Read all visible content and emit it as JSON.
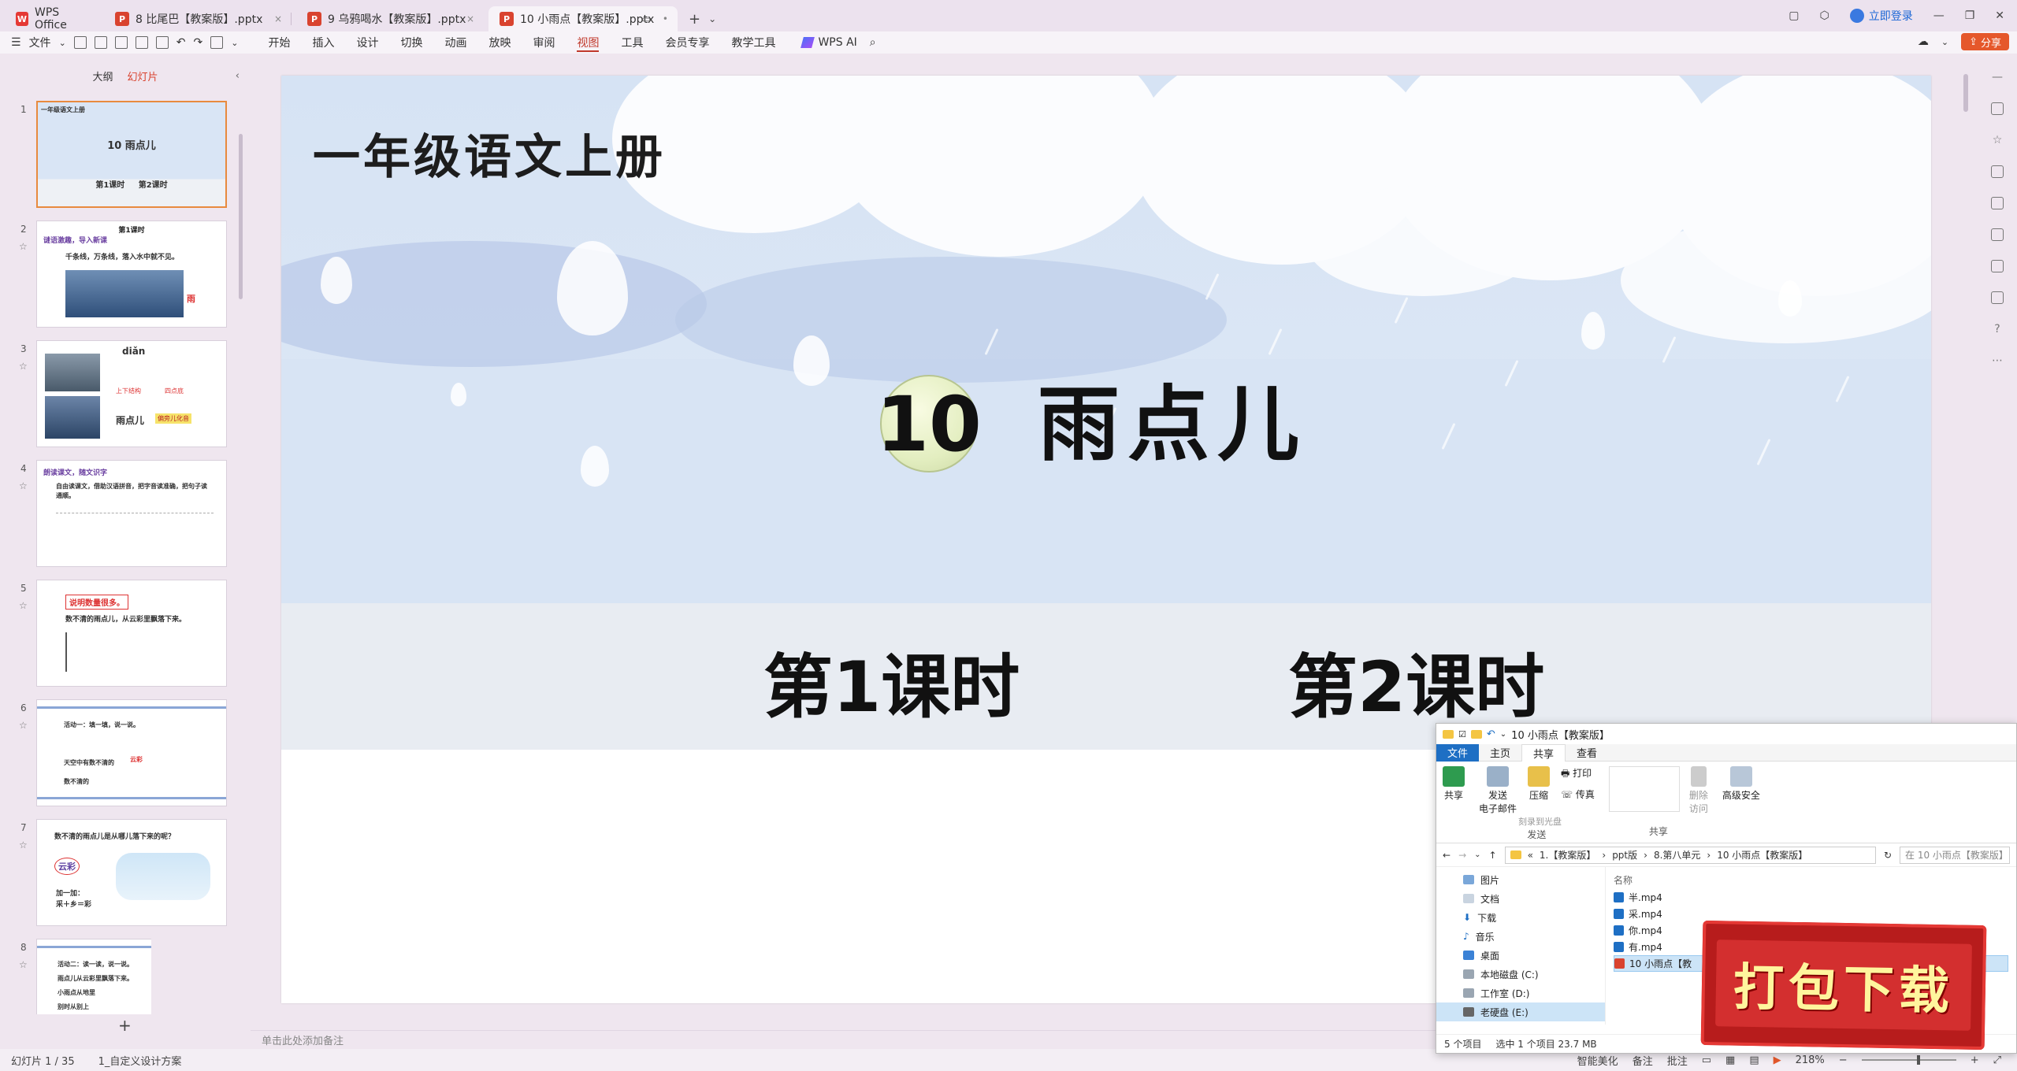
{
  "titlebar": {
    "tabs": [
      {
        "label": "WPS Office",
        "type": "home"
      },
      {
        "label": "8 比尾巴【教案版】.pptx",
        "type": "doc"
      },
      {
        "label": "9 乌鸦喝水【教案版】.pptx",
        "type": "doc"
      },
      {
        "label": "10 小雨点【教案版】.pptx",
        "type": "doc",
        "active": true
      }
    ],
    "login_label": "立即登录"
  },
  "menubar": {
    "file_label": "文件",
    "items": [
      "开始",
      "插入",
      "设计",
      "切换",
      "动画",
      "放映",
      "审阅",
      "视图",
      "工具",
      "会员专享",
      "教学工具"
    ],
    "active_item": "视图",
    "ai_label": "WPS AI",
    "share_label": "分享"
  },
  "left_panel": {
    "tab_outline": "大纲",
    "tab_slides": "幻灯片",
    "slides": [
      {
        "num": "1",
        "title": "10 雨点儿",
        "sub": "第1课时     第2课时",
        "header": "一年级语文上册"
      },
      {
        "num": "2",
        "title": "第1课时",
        "section": "谜语激趣，导入新课",
        "line": "千条线，万条线，落入水中就不见。",
        "answer": "雨"
      },
      {
        "num": "3",
        "pinyin": "diǎn",
        "word": "雨点儿",
        "note": "上下结构",
        "note2": "四点底",
        "badge": "偏旁儿化音"
      },
      {
        "num": "4",
        "section": "朗读课文，随文识字",
        "line": "自由读课文，借助汉语拼音，把字音读准确，把句子读通顺。"
      },
      {
        "num": "5",
        "tag": "说明数量很多。",
        "line": "数不清的雨点儿，从云彩里飘落下来。"
      },
      {
        "num": "6",
        "line1": "活动一：填一填，说一说。",
        "line2": "天空中有数不清的",
        "line3": "数不清的",
        "answer": "云彩"
      },
      {
        "num": "7",
        "line": "数不清的雨点儿是从哪儿落下来的呢？",
        "word": "云彩",
        "line2": "加一加：",
        "line3": "采＋乡＝彩"
      },
      {
        "num": "8",
        "line1": "活动二：读一读，说一说。",
        "line2": "雨点儿从云彩里飘落下来。",
        "line3": "小雨点从地里",
        "line4": "别时从别上"
      }
    ]
  },
  "slide": {
    "grade": "一年级语文上册",
    "lesson_num": "10",
    "lesson_title": "雨点儿",
    "period1": "第1课时",
    "period2": "第2课时"
  },
  "notes_placeholder": "单击此处添加备注",
  "statusbar": {
    "slide_counter": "幻灯片 1 / 35",
    "theme": "1_自定义设计方案",
    "beautify": "智能美化",
    "notes": "备注",
    "comments": "批注",
    "zoom": "218%"
  },
  "explorer": {
    "title": "10 小雨点【教案版】",
    "tabs": [
      "文件",
      "主页",
      "共享",
      "查看"
    ],
    "active_tab": "共享",
    "ribbon": {
      "share": "共享",
      "send_email": "发送\n电子邮件",
      "zip": "压缩",
      "print": "打印",
      "fax": "传真",
      "burn": "刻录到光盘",
      "remove_access": "删除\n访问",
      "advanced_security": "高级安全",
      "group_send": "发送",
      "group_share": "共享"
    },
    "breadcrumb": [
      "1.【教案版】",
      "ppt版",
      "8.第八单元",
      "10 小雨点【教案版】"
    ],
    "search_placeholder": "在 10 小雨点【教案版】",
    "nav": [
      "图片",
      "文档",
      "下载",
      "音乐",
      "桌面",
      "本地磁盘 (C:)",
      "工作室 (D:)",
      "老硬盘 (E:)"
    ],
    "nav_selected": "老硬盘 (E:)",
    "column_name": "名称",
    "files": [
      "半.mp4",
      "采.mp4",
      "你.mp4",
      "有.mp4",
      "10 小雨点【教"
    ],
    "selected_file": "10 小雨点【教",
    "status_count": "5 个项目",
    "status_selected": "选中 1 个项目  23.7 MB"
  },
  "stamp_label": "打包下载"
}
